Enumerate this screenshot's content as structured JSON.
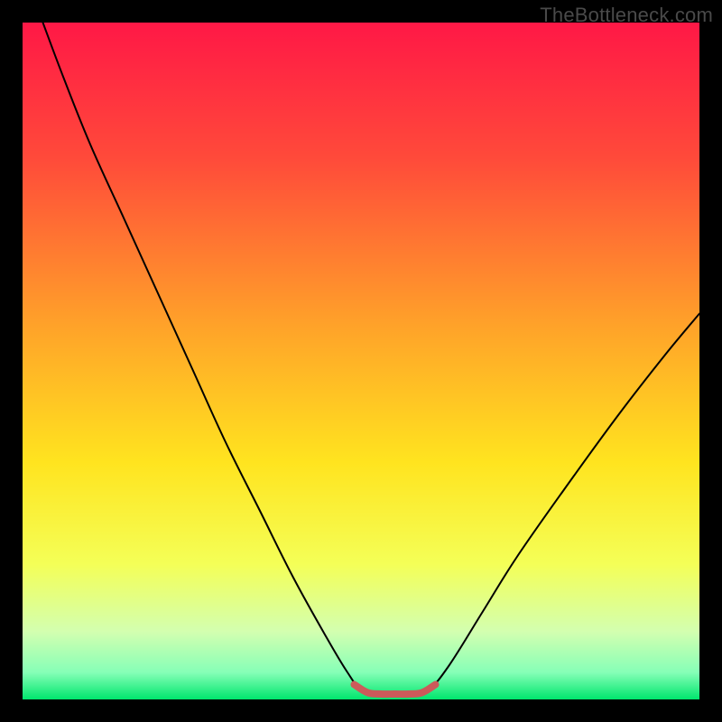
{
  "watermark": "TheBottleneck.com",
  "chart_data": {
    "type": "line",
    "title": "",
    "xlabel": "",
    "ylabel": "",
    "xlim": [
      0,
      100
    ],
    "ylim": [
      0,
      100
    ],
    "grid": false,
    "legend": false,
    "gradient_stops": [
      {
        "pct": 0,
        "color": "#ff1846"
      },
      {
        "pct": 20,
        "color": "#ff4a3a"
      },
      {
        "pct": 45,
        "color": "#ffa329"
      },
      {
        "pct": 65,
        "color": "#ffe41f"
      },
      {
        "pct": 80,
        "color": "#f4ff57"
      },
      {
        "pct": 90,
        "color": "#d3ffb0"
      },
      {
        "pct": 96,
        "color": "#86ffb7"
      },
      {
        "pct": 100,
        "color": "#00e66d"
      }
    ],
    "series": [
      {
        "name": "bottleneck-curve",
        "color": "#000000",
        "points": [
          {
            "x": 3,
            "y": 100
          },
          {
            "x": 6,
            "y": 92
          },
          {
            "x": 10,
            "y": 82
          },
          {
            "x": 15,
            "y": 71
          },
          {
            "x": 20,
            "y": 60
          },
          {
            "x": 25,
            "y": 49
          },
          {
            "x": 30,
            "y": 38
          },
          {
            "x": 35,
            "y": 28
          },
          {
            "x": 40,
            "y": 18
          },
          {
            "x": 45,
            "y": 9
          },
          {
            "x": 48,
            "y": 4
          },
          {
            "x": 50,
            "y": 1.5
          },
          {
            "x": 53,
            "y": 0.6
          },
          {
            "x": 57,
            "y": 0.6
          },
          {
            "x": 60,
            "y": 1.5
          },
          {
            "x": 63,
            "y": 5
          },
          {
            "x": 68,
            "y": 13
          },
          {
            "x": 73,
            "y": 21
          },
          {
            "x": 80,
            "y": 31
          },
          {
            "x": 88,
            "y": 42
          },
          {
            "x": 95,
            "y": 51
          },
          {
            "x": 100,
            "y": 57
          }
        ]
      },
      {
        "name": "flat-optimum-band",
        "color": "#cc5a5a",
        "points": [
          {
            "x": 49,
            "y": 2.2
          },
          {
            "x": 51,
            "y": 1.0
          },
          {
            "x": 53,
            "y": 0.8
          },
          {
            "x": 55,
            "y": 0.8
          },
          {
            "x": 57,
            "y": 0.8
          },
          {
            "x": 59,
            "y": 1.0
          },
          {
            "x": 61,
            "y": 2.2
          }
        ]
      }
    ]
  }
}
